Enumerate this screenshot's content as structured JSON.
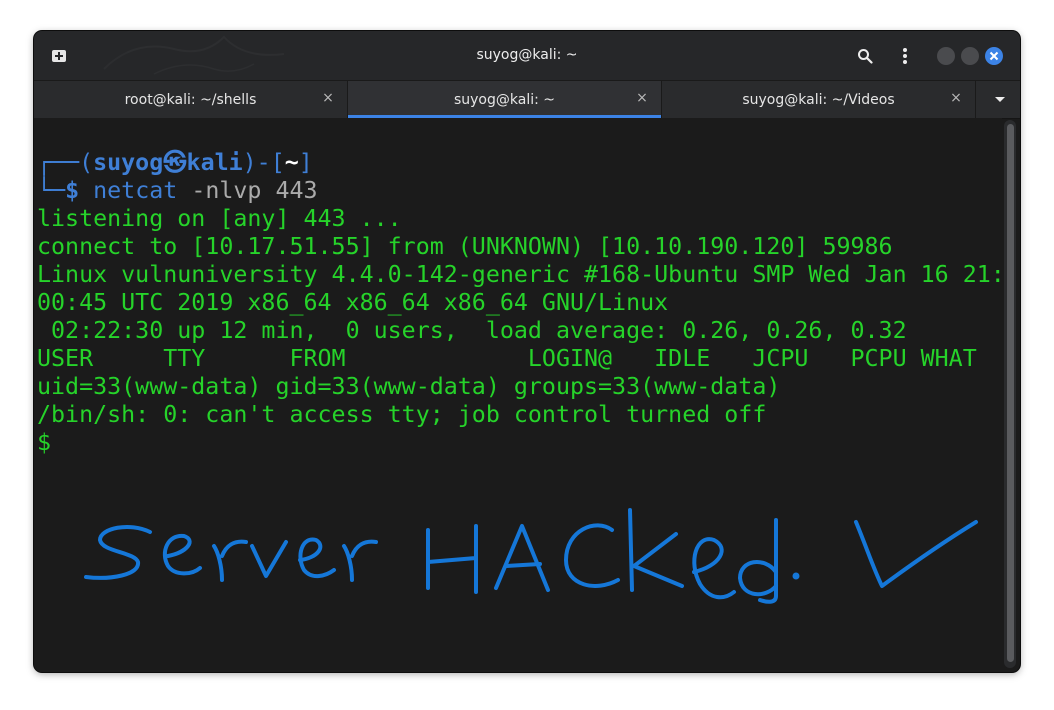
{
  "window": {
    "title": "suyog@kali: ~",
    "accent_color": "#3c83e6",
    "icons": {
      "new_tab": "new-tab-icon",
      "search": "search-icon",
      "menu": "kebab-menu-icon",
      "minimize": "minimize-icon",
      "maximize": "maximize-icon",
      "close": "close-icon"
    }
  },
  "tabs": [
    {
      "label": "root@kali: ~/shells",
      "active": false
    },
    {
      "label": "suyog@kali: ~",
      "active": true
    },
    {
      "label": "suyog@kali: ~/Videos",
      "active": false
    }
  ],
  "terminal": {
    "prompt": {
      "frame_top_prefix": "┌──(",
      "user": "suyog",
      "separator": "㉿",
      "host": "kali",
      "frame_mid": ")-[",
      "dir": "~",
      "frame_end": "]",
      "frame_bottom": "└─",
      "symbol": "$",
      "command": "netcat",
      "args": "-nlvp 443"
    },
    "output_lines": [
      "listening on [any] 443 ...",
      "connect to [10.17.51.55] from (UNKNOWN) [10.10.190.120] 59986",
      "Linux vulnuniversity 4.4.0-142-generic #168-Ubuntu SMP Wed Jan 16 21:",
      "00:45 UTC 2019 x86_64 x86_64 x86_64 GNU/Linux",
      " 02:22:30 up 12 min,  0 users,  load average: 0.26, 0.26, 0.32",
      "USER     TTY      FROM             LOGIN@   IDLE   JCPU   PCPU WHAT",
      "uid=33(www-data) gid=33(www-data) groups=33(www-data)",
      "/bin/sh: 0: can't access tty; job control turned off",
      "$"
    ],
    "colors": {
      "output": "#26d32a",
      "prompt": "#3f7fd6",
      "background": "#1b1b1b"
    }
  },
  "annotation": {
    "handwritten_text": "server HACKed. ✓",
    "color": "#1577d8"
  }
}
